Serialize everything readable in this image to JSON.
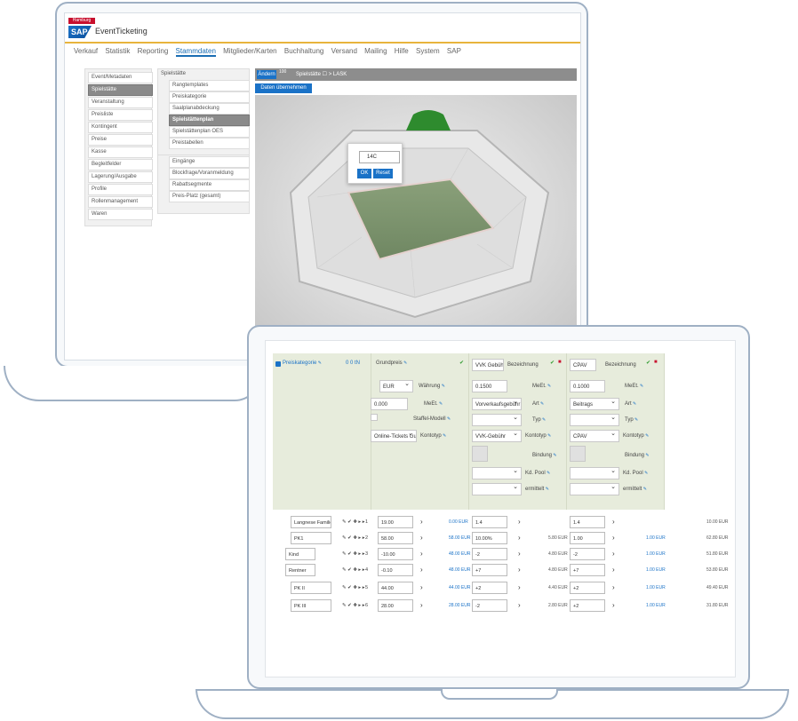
{
  "back_app": {
    "kicker": "Hamburg",
    "logo": "SAP",
    "title": "EventTicketing",
    "menu": [
      "Verkauf",
      "Statistik",
      "Reporting",
      "Stammdaten",
      "Mitglieder/Karten",
      "Buchhaltung",
      "Versand",
      "Mailing",
      "Hilfe",
      "System",
      "SAP"
    ],
    "menu_active": "Stammdaten",
    "sidebar": [
      "Event/Metadaten",
      "Spielstätte",
      "Veranstaltung",
      "Preisliste",
      "Kontingent",
      "Preise",
      "Kasse",
      "Begleitfelder",
      "Lagerung/Ausgabe",
      "Profile",
      "Rollenmanagement",
      "Waren"
    ],
    "sidebar_selected": "Spielstätte",
    "sub_header": "Spielstätte",
    "submenu": [
      "Rangtemplates",
      "Preiskategorie",
      "Saalplanabdeckung",
      "Spielstättenplan",
      "Spielstättenplan OES",
      "Preistabellen",
      "Eingänge",
      "Blockfrage/Voranmeldung",
      "Rabattsegmente",
      "Preis-Platz (gesamt)"
    ],
    "submenu_selected": "Spielstättenplan",
    "stad_btn": "Ändern",
    "stad_num": "100",
    "stad_title": "Spielstätte ☐ > LASK",
    "take_btn": "Daten übernehmen",
    "popup_value": "14C",
    "popup_ok": "OK",
    "popup_reset": "Reset"
  },
  "front_app": {
    "col1_header": "Preiskategorie",
    "col1_icons": "0 0 tN",
    "col2_header": "Grundpreis",
    "col3_header": "VVK Gebühr",
    "col3_bez": "Bezeichnung",
    "col4_header": "CPAV",
    "col4_bez": "Bezeichnung",
    "waehrung_value": "EUR",
    "waehrung_label": "Währung",
    "meh_value": "0.000",
    "meh_label": "MeEt.",
    "staffel_label": "Staffel-Modell",
    "konto_value": "Online-Tickets Gu",
    "konto_label": "Kontotyp",
    "col3_meh_value": "0.1500",
    "col3_meh_label": "MeEt.",
    "col3_art_value": "Vorverkaufsgebühr",
    "col3_art_label": "Art",
    "col3_typ_label": "Typ",
    "col3_konto_value": "VVK-Gebühr",
    "col3_konto_label": "Kontotyp",
    "col3_bindung_label": "Bindung",
    "col3_kd_label": "Kd. Pool",
    "col3_ermittelt_label": "ermittelt",
    "col4_meh_value": "0.1000",
    "col4_meh_label": "MeEt.",
    "col4_art_value": "Beitrags",
    "col4_art_label": "Art",
    "col4_typ_label": "Typ",
    "col4_konto_value": "CPAV",
    "col4_konto_label": "Kontotyp",
    "col4_bindung_label": "Bindung",
    "col4_kd_label": "Kd. Pool",
    "col4_ermittelt_label": "ermittelt",
    "rows": [
      {
        "name": "Langnese Familie",
        "idx": "1",
        "price": "19.00",
        "blue": "0.00 EUR",
        "vvk": "1.4",
        "vvk_eur": "",
        "cpav": "1.4",
        "cpav_eur": "",
        "total": "10.00 EUR",
        "indent": false
      },
      {
        "name": "PK1",
        "idx": "2",
        "price": "58.00",
        "blue": "58.00 EUR",
        "vvk": "10.00%",
        "vvk_eur": "5.80 EUR",
        "cpav": "1.00",
        "cpav_eur": "1.00 EUR",
        "total": "62.80 EUR",
        "indent": false
      },
      {
        "name": "Kind",
        "idx": "3",
        "price": "-10.00",
        "blue": "48.00 EUR",
        "vvk": "-2",
        "vvk_eur": "4.80 EUR",
        "cpav": "-2",
        "cpav_eur": "1.00 EUR",
        "total": "51.80 EUR",
        "indent": true
      },
      {
        "name": "Rentner",
        "idx": "4",
        "price": "-0.10",
        "blue": "48.00 EUR",
        "vvk": "+7",
        "vvk_eur": "4.80 EUR",
        "cpav": "+7",
        "cpav_eur": "1.00 EUR",
        "total": "53.80 EUR",
        "indent": true
      },
      {
        "name": "PK II",
        "idx": "5",
        "price": "44.00",
        "blue": "44.00 EUR",
        "vvk": "+2",
        "vvk_eur": "4.40 EUR",
        "cpav": "+2",
        "cpav_eur": "1.00 EUR",
        "total": "49.40 EUR",
        "indent": false
      },
      {
        "name": "PK III",
        "idx": "6",
        "price": "28.00",
        "blue": "28.00 EUR",
        "vvk": "-2",
        "vvk_eur": "2.80 EUR",
        "cpav": "+2",
        "cpav_eur": "1.00 EUR",
        "total": "31.80 EUR",
        "indent": false
      }
    ]
  },
  "colors": {
    "sap_blue": "#1a72c7",
    "gold": "#e8b43c",
    "green": "#2e9b2e",
    "red": "#c8102e",
    "panel": "#e7ecdc"
  }
}
